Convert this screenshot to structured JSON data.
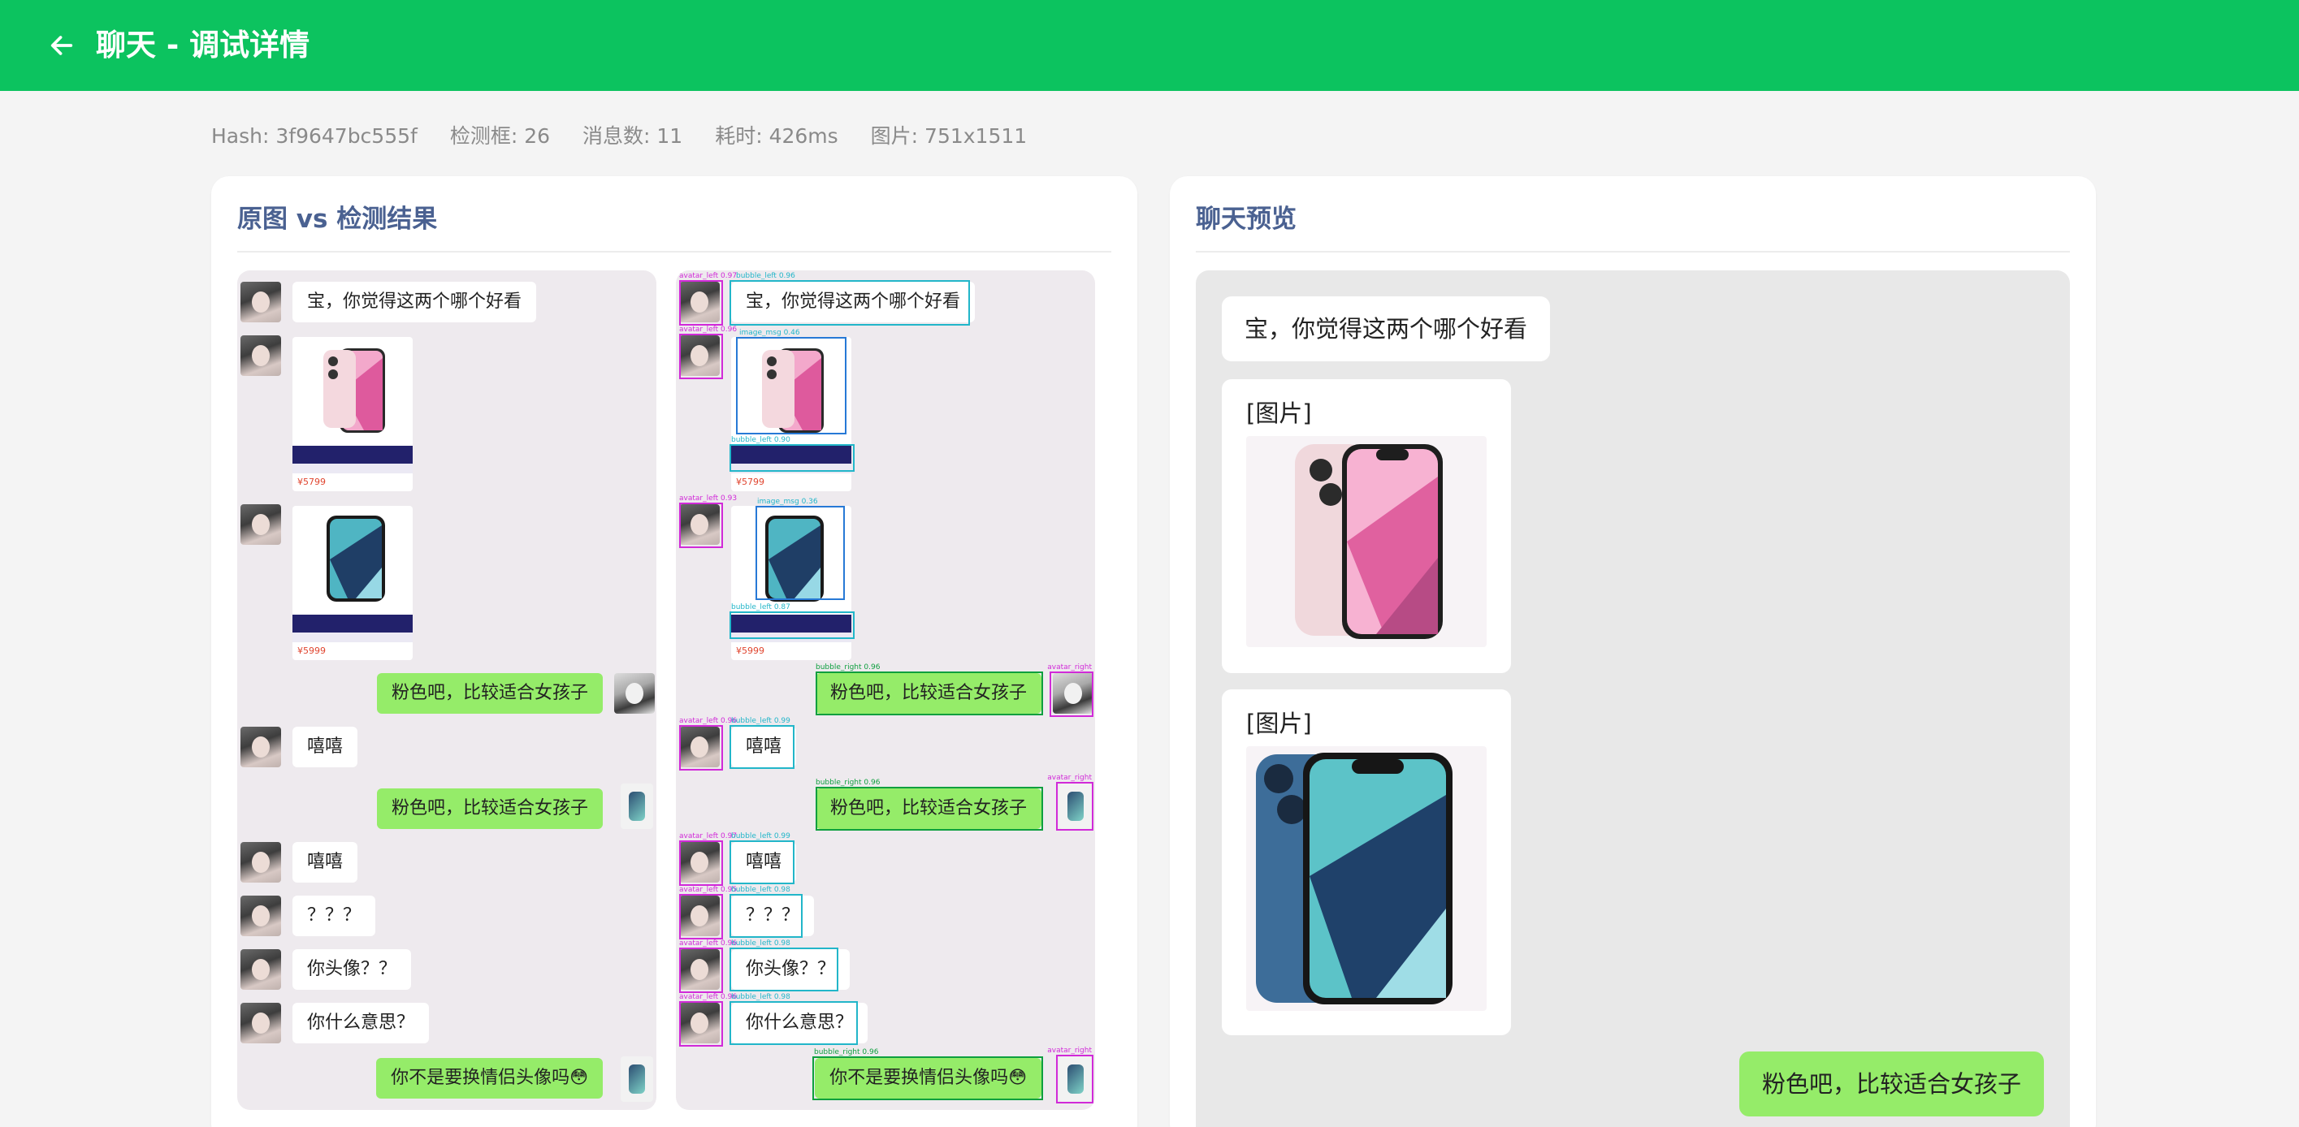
{
  "header": {
    "title": "聊天 - 调试详情",
    "back_icon": "arrow-left-icon",
    "bg_color": "#0cc35f"
  },
  "meta": {
    "hash": "Hash: 3f9647bc555f",
    "boxes": "检测框: 26",
    "messages": "消息数: 11",
    "elapsed": "耗时: 426ms",
    "image": "图片: 751x1511"
  },
  "left_card": {
    "title": "原图 vs 检测结果"
  },
  "right_card": {
    "title": "聊天预览"
  },
  "chat": {
    "m1": "宝，你觉得这两个哪个好看",
    "m4": "粉色吧，比较适合女孩子",
    "m5": "嘻嘻",
    "m6": "粉色吧，比较适合女孩子",
    "m7": "嘻嘻",
    "m8": "？？？",
    "m9": "你头像？？",
    "m10": "你什么意思？",
    "m11": "你不是要换情侣头像吗😳",
    "price_pink": "¥5799",
    "price_blue": "¥5999"
  },
  "detection_labels": {
    "avatar_left_1": "avatar_left 0.97",
    "bubble_left_1": "bubble_left 0.96",
    "avatar_left_2": "avatar_left 0.96",
    "image_msg_1": "image_msg 0.46",
    "bubble_left_2": "bubble_left 0.90",
    "avatar_left_3": "avatar_left 0.93",
    "image_msg_2": "image_msg 0.36",
    "bubble_left_3": "bubble_left 0.87",
    "bubble_right_1": "bubble_right 0.96",
    "avatar_right_1": "avatar_right",
    "avatar_left_4": "avatar_left 0.96",
    "bubble_left_4": "bubble_left 0.99",
    "bubble_right_2": "bubble_right 0.96",
    "avatar_right_2": "avatar_right",
    "avatar_left_5": "avatar_left 0.97",
    "bubble_left_5": "bubble_left 0.99",
    "avatar_left_6": "avatar_left 0.95",
    "bubble_left_6": "bubble_left 0.98",
    "avatar_left_7": "avatar_left 0.96",
    "bubble_left_7": "bubble_left 0.98",
    "avatar_left_8": "avatar_left 0.96",
    "bubble_left_8": "bubble_left 0.98",
    "bubble_right_3": "bubble_right 0.96",
    "avatar_right_3": "avatar_right"
  },
  "preview": {
    "msg1": "宝，你觉得这两个哪个好看",
    "img_tag_1": "[图片]",
    "img_tag_2": "[图片]",
    "msg4": "粉色吧，比较适合女孩子"
  },
  "colors": {
    "accent_title": "#4a6191",
    "my_bubble": "#95ec69",
    "box_bubble": "#22b6c9",
    "box_avatar": "#d12ad8",
    "box_image": "#2779d6",
    "box_right": "#0d9f3e"
  }
}
